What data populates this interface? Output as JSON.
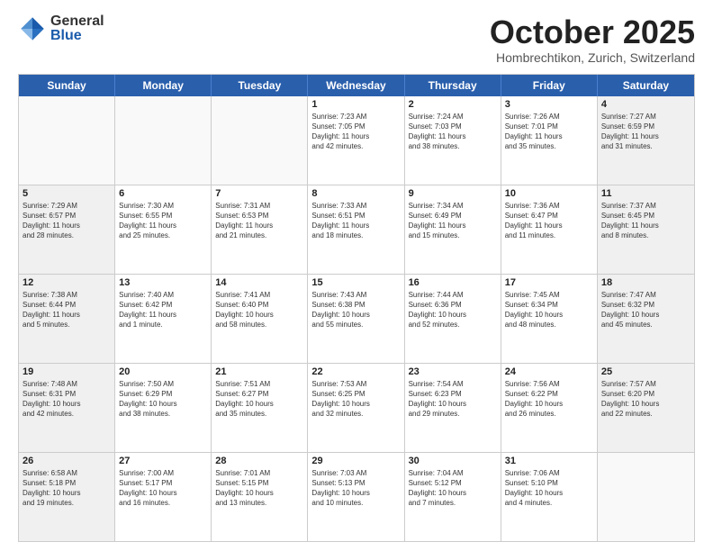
{
  "header": {
    "logo_general": "General",
    "logo_blue": "Blue",
    "month_title": "October 2025",
    "location": "Hombrechtikon, Zurich, Switzerland"
  },
  "weekdays": [
    "Sunday",
    "Monday",
    "Tuesday",
    "Wednesday",
    "Thursday",
    "Friday",
    "Saturday"
  ],
  "weeks": [
    [
      {
        "day": "",
        "info": "",
        "shaded": true
      },
      {
        "day": "",
        "info": "",
        "shaded": true
      },
      {
        "day": "",
        "info": "",
        "shaded": true
      },
      {
        "day": "1",
        "info": "Sunrise: 7:23 AM\nSunset: 7:05 PM\nDaylight: 11 hours\nand 42 minutes.",
        "shaded": false
      },
      {
        "day": "2",
        "info": "Sunrise: 7:24 AM\nSunset: 7:03 PM\nDaylight: 11 hours\nand 38 minutes.",
        "shaded": false
      },
      {
        "day": "3",
        "info": "Sunrise: 7:26 AM\nSunset: 7:01 PM\nDaylight: 11 hours\nand 35 minutes.",
        "shaded": false
      },
      {
        "day": "4",
        "info": "Sunrise: 7:27 AM\nSunset: 6:59 PM\nDaylight: 11 hours\nand 31 minutes.",
        "shaded": true
      }
    ],
    [
      {
        "day": "5",
        "info": "Sunrise: 7:29 AM\nSunset: 6:57 PM\nDaylight: 11 hours\nand 28 minutes.",
        "shaded": true
      },
      {
        "day": "6",
        "info": "Sunrise: 7:30 AM\nSunset: 6:55 PM\nDaylight: 11 hours\nand 25 minutes.",
        "shaded": false
      },
      {
        "day": "7",
        "info": "Sunrise: 7:31 AM\nSunset: 6:53 PM\nDaylight: 11 hours\nand 21 minutes.",
        "shaded": false
      },
      {
        "day": "8",
        "info": "Sunrise: 7:33 AM\nSunset: 6:51 PM\nDaylight: 11 hours\nand 18 minutes.",
        "shaded": false
      },
      {
        "day": "9",
        "info": "Sunrise: 7:34 AM\nSunset: 6:49 PM\nDaylight: 11 hours\nand 15 minutes.",
        "shaded": false
      },
      {
        "day": "10",
        "info": "Sunrise: 7:36 AM\nSunset: 6:47 PM\nDaylight: 11 hours\nand 11 minutes.",
        "shaded": false
      },
      {
        "day": "11",
        "info": "Sunrise: 7:37 AM\nSunset: 6:45 PM\nDaylight: 11 hours\nand 8 minutes.",
        "shaded": true
      }
    ],
    [
      {
        "day": "12",
        "info": "Sunrise: 7:38 AM\nSunset: 6:44 PM\nDaylight: 11 hours\nand 5 minutes.",
        "shaded": true
      },
      {
        "day": "13",
        "info": "Sunrise: 7:40 AM\nSunset: 6:42 PM\nDaylight: 11 hours\nand 1 minute.",
        "shaded": false
      },
      {
        "day": "14",
        "info": "Sunrise: 7:41 AM\nSunset: 6:40 PM\nDaylight: 10 hours\nand 58 minutes.",
        "shaded": false
      },
      {
        "day": "15",
        "info": "Sunrise: 7:43 AM\nSunset: 6:38 PM\nDaylight: 10 hours\nand 55 minutes.",
        "shaded": false
      },
      {
        "day": "16",
        "info": "Sunrise: 7:44 AM\nSunset: 6:36 PM\nDaylight: 10 hours\nand 52 minutes.",
        "shaded": false
      },
      {
        "day": "17",
        "info": "Sunrise: 7:45 AM\nSunset: 6:34 PM\nDaylight: 10 hours\nand 48 minutes.",
        "shaded": false
      },
      {
        "day": "18",
        "info": "Sunrise: 7:47 AM\nSunset: 6:32 PM\nDaylight: 10 hours\nand 45 minutes.",
        "shaded": true
      }
    ],
    [
      {
        "day": "19",
        "info": "Sunrise: 7:48 AM\nSunset: 6:31 PM\nDaylight: 10 hours\nand 42 minutes.",
        "shaded": true
      },
      {
        "day": "20",
        "info": "Sunrise: 7:50 AM\nSunset: 6:29 PM\nDaylight: 10 hours\nand 38 minutes.",
        "shaded": false
      },
      {
        "day": "21",
        "info": "Sunrise: 7:51 AM\nSunset: 6:27 PM\nDaylight: 10 hours\nand 35 minutes.",
        "shaded": false
      },
      {
        "day": "22",
        "info": "Sunrise: 7:53 AM\nSunset: 6:25 PM\nDaylight: 10 hours\nand 32 minutes.",
        "shaded": false
      },
      {
        "day": "23",
        "info": "Sunrise: 7:54 AM\nSunset: 6:23 PM\nDaylight: 10 hours\nand 29 minutes.",
        "shaded": false
      },
      {
        "day": "24",
        "info": "Sunrise: 7:56 AM\nSunset: 6:22 PM\nDaylight: 10 hours\nand 26 minutes.",
        "shaded": false
      },
      {
        "day": "25",
        "info": "Sunrise: 7:57 AM\nSunset: 6:20 PM\nDaylight: 10 hours\nand 22 minutes.",
        "shaded": true
      }
    ],
    [
      {
        "day": "26",
        "info": "Sunrise: 6:58 AM\nSunset: 5:18 PM\nDaylight: 10 hours\nand 19 minutes.",
        "shaded": true
      },
      {
        "day": "27",
        "info": "Sunrise: 7:00 AM\nSunset: 5:17 PM\nDaylight: 10 hours\nand 16 minutes.",
        "shaded": false
      },
      {
        "day": "28",
        "info": "Sunrise: 7:01 AM\nSunset: 5:15 PM\nDaylight: 10 hours\nand 13 minutes.",
        "shaded": false
      },
      {
        "day": "29",
        "info": "Sunrise: 7:03 AM\nSunset: 5:13 PM\nDaylight: 10 hours\nand 10 minutes.",
        "shaded": false
      },
      {
        "day": "30",
        "info": "Sunrise: 7:04 AM\nSunset: 5:12 PM\nDaylight: 10 hours\nand 7 minutes.",
        "shaded": false
      },
      {
        "day": "31",
        "info": "Sunrise: 7:06 AM\nSunset: 5:10 PM\nDaylight: 10 hours\nand 4 minutes.",
        "shaded": false
      },
      {
        "day": "",
        "info": "",
        "shaded": true
      }
    ]
  ]
}
